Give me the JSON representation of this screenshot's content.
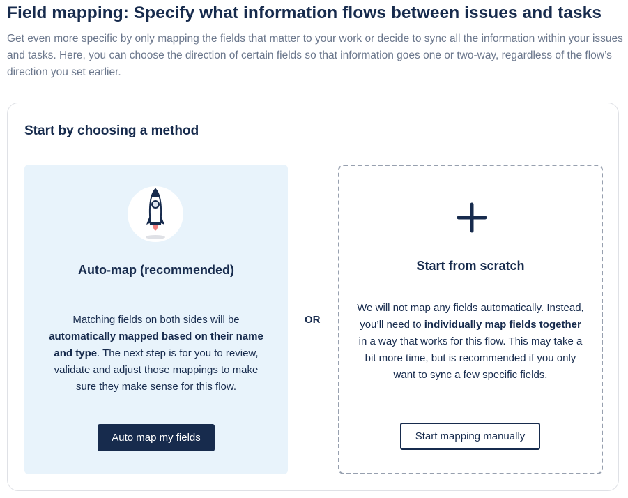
{
  "header": {
    "title": "Field mapping: Specify what information flows between issues and tasks",
    "subtitle": "Get even more specific by only mapping the fields that matter to your work or decide to sync all the information within your issues and tasks. Here, you can choose the direction of certain fields so that information goes one or two-way, regardless of the flow’s direction you set earlier."
  },
  "method_card": {
    "heading": "Start by choosing a method",
    "separator": "OR",
    "auto_map": {
      "icon": "rocket-icon",
      "title": "Auto-map (recommended)",
      "description": [
        {
          "text": "Matching fields on both sides will be ",
          "bold": false
        },
        {
          "text": "automatically mapped based on their name and type",
          "bold": true
        },
        {
          "text": ". The next step is for you to review, validate and adjust those mappings to make sure they make sense for this flow.",
          "bold": false
        }
      ],
      "button_label": "Auto map my fields"
    },
    "scratch": {
      "icon": "plus-icon",
      "title": "Start from scratch",
      "description": [
        {
          "text": "We will not map any fields automatically. Instead, you’ll need to ",
          "bold": false
        },
        {
          "text": "individually map fields together",
          "bold": true
        },
        {
          "text": " in a way that works for this flow. This may take a bit more time, but is recommended if you only want to sync a few specific fields.",
          "bold": false
        }
      ],
      "button_label": "Start mapping manually"
    }
  },
  "colors": {
    "primary": "#172b4d",
    "muted_text": "#6b778c",
    "auto_panel_bg": "#e8f3fb",
    "dashed_border": "#97a0af",
    "rocket_flame": "#f08080"
  }
}
